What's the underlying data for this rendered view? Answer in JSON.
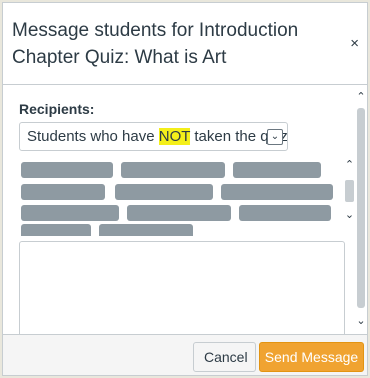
{
  "dialog": {
    "title": "Message students for Introduction Chapter Quiz: What is Art",
    "close_icon": "close-icon",
    "close_glyph": "×"
  },
  "recipients": {
    "label": "Recipients:",
    "select_prefix": "Students who have ",
    "select_highlight": "NOT",
    "select_suffix": " taken the quiz",
    "arrow_glyph": "⌄"
  },
  "message": {
    "value": ""
  },
  "scroll": {
    "up_glyph": "⌃",
    "down_glyph": "⌄"
  },
  "footer": {
    "cancel_label": "Cancel",
    "send_label": "Send Message"
  },
  "colors": {
    "send_button": "#f0a331",
    "highlight": "#f4ef1a",
    "redacted_chip": "#8e9aa2"
  }
}
